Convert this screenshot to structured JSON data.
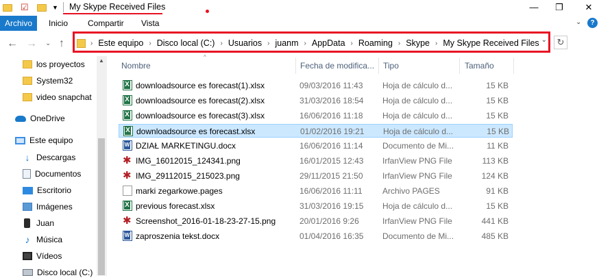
{
  "window": {
    "title": "My Skype Received Files",
    "min": "—",
    "max": "❐",
    "close": "✕"
  },
  "ribbon": {
    "tabs": [
      "Archivo",
      "Inicio",
      "Compartir",
      "Vista"
    ],
    "expand": "⌄",
    "help": "?"
  },
  "nav": {
    "back": "←",
    "forward": "→",
    "recent": "⌄",
    "up": "↑",
    "refresh": "↻",
    "breadcrumbs": [
      "Este equipo",
      "Disco local (C:)",
      "Usuarios",
      "juanm",
      "AppData",
      "Roaming",
      "Skype",
      "My Skype Received Files"
    ],
    "sep": "›",
    "dropdown": "⌄"
  },
  "sidebar": {
    "items": [
      {
        "label": "los proyectos",
        "icon": "folder-icon"
      },
      {
        "label": "System32",
        "icon": "folder-icon"
      },
      {
        "label": "video snapchat",
        "icon": "folder-icon"
      },
      {
        "label": "OneDrive",
        "icon": "onedrive-icon"
      },
      {
        "label": "Este equipo",
        "icon": "computer-icon"
      },
      {
        "label": "Descargas",
        "icon": "downloads-icon"
      },
      {
        "label": "Documentos",
        "icon": "documents-icon"
      },
      {
        "label": "Escritorio",
        "icon": "desktop-icon"
      },
      {
        "label": "Imágenes",
        "icon": "pictures-icon"
      },
      {
        "label": "Juan",
        "icon": "user-icon"
      },
      {
        "label": "Música",
        "icon": "music-icon"
      },
      {
        "label": "Vídeos",
        "icon": "videos-icon"
      },
      {
        "label": "Disco local (C:)",
        "icon": "drive-icon"
      }
    ]
  },
  "list": {
    "columns": [
      "Nombre",
      "Fecha de modifica...",
      "Tipo",
      "Tamaño"
    ],
    "sort_indicator": "^",
    "rows": [
      {
        "name": "downloadsource es forecast(1).xlsx",
        "date": "09/03/2016 11:43",
        "type": "Hoja de cálculo d...",
        "size": "15 KB",
        "icon": "xlsx"
      },
      {
        "name": "downloadsource es forecast(2).xlsx",
        "date": "31/03/2016 18:54",
        "type": "Hoja de cálculo d...",
        "size": "15 KB",
        "icon": "xlsx"
      },
      {
        "name": "downloadsource es forecast(3).xlsx",
        "date": "16/06/2016 11:18",
        "type": "Hoja de cálculo d...",
        "size": "15 KB",
        "icon": "xlsx"
      },
      {
        "name": "downloadsource es forecast.xlsx",
        "date": "01/02/2016 19:21",
        "type": "Hoja de cálculo d...",
        "size": "15 KB",
        "icon": "xlsx",
        "selected": true
      },
      {
        "name": "DZIAŁ MARKETINGU.docx",
        "date": "16/06/2016 11:14",
        "type": "Documento de Mi...",
        "size": "11 KB",
        "icon": "docx"
      },
      {
        "name": "IMG_16012015_124341.png",
        "date": "16/01/2015 12:43",
        "type": "IrfanView PNG File",
        "size": "113 KB",
        "icon": "png"
      },
      {
        "name": "IMG_29112015_215023.png",
        "date": "29/11/2015 21:50",
        "type": "IrfanView PNG File",
        "size": "124 KB",
        "icon": "png"
      },
      {
        "name": "marki zegarkowe.pages",
        "date": "16/06/2016 11:11",
        "type": "Archivo PAGES",
        "size": "91 KB",
        "icon": "pages"
      },
      {
        "name": "previous forecast.xlsx",
        "date": "31/03/2016 19:15",
        "type": "Hoja de cálculo d...",
        "size": "15 KB",
        "icon": "xlsx"
      },
      {
        "name": "Screenshot_2016-01-18-23-27-15.png",
        "date": "20/01/2016 9:26",
        "type": "IrfanView PNG File",
        "size": "441 KB",
        "icon": "png"
      },
      {
        "name": "zaproszenia tekst.docx",
        "date": "01/04/2016 16:35",
        "type": "Documento de Mi...",
        "size": "485 KB",
        "icon": "docx"
      }
    ]
  },
  "colors": {
    "accent": "#1979ca",
    "highlight": "#e81123",
    "selection": "#cce8ff"
  }
}
